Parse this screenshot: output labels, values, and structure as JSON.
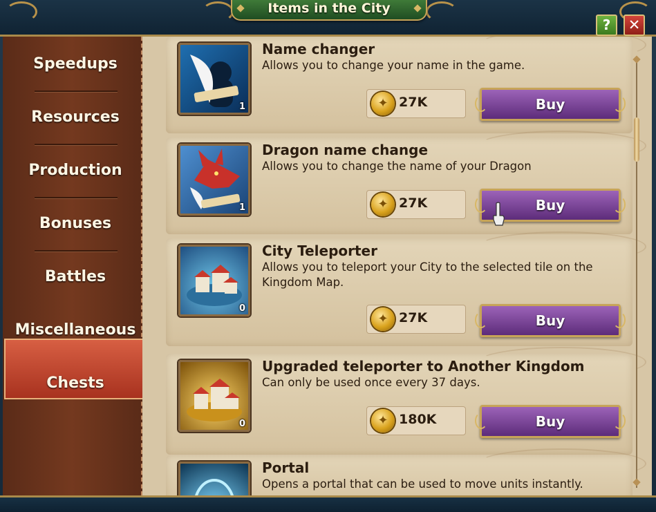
{
  "window": {
    "title": "Items in the City",
    "help_label": "?",
    "close_label": "✕"
  },
  "sidebar": {
    "items": [
      {
        "label": "Speedups"
      },
      {
        "label": "Resources"
      },
      {
        "label": "Production"
      },
      {
        "label": "Bonuses"
      },
      {
        "label": "Battles"
      },
      {
        "label": "Miscellaneous",
        "active": true
      },
      {
        "label": "Chests"
      }
    ]
  },
  "items": [
    {
      "name": "Name changer",
      "description": "Allows you to change your name in the game.",
      "count": "1",
      "price": "27K",
      "buy_label": "Buy",
      "icon": "quill-name-icon"
    },
    {
      "name": "Dragon name change",
      "description": "Allows you to change the name of your Dragon",
      "count": "1",
      "price": "27K",
      "buy_label": "Buy",
      "icon": "dragon-icon"
    },
    {
      "name": "City Teleporter",
      "description": "Allows you to teleport your City to the selected tile on the Kingdom Map.",
      "count": "0",
      "price": "27K",
      "buy_label": "Buy",
      "icon": "city-icon"
    },
    {
      "name": "Upgraded teleporter to Another Kingdom",
      "description": "Can only be used once every 37 days.",
      "count": "0",
      "price": "180K",
      "buy_label": "Buy",
      "icon": "golden-city-icon"
    },
    {
      "name": "Portal",
      "description": "Opens a portal that can be used to move units instantly.",
      "icon": "portal-icon"
    }
  ],
  "colors": {
    "accent_buy": "#7b43a0",
    "active_tab": "#c2482f",
    "header_green": "#2f6a2f",
    "coin": "#d9a21d"
  }
}
